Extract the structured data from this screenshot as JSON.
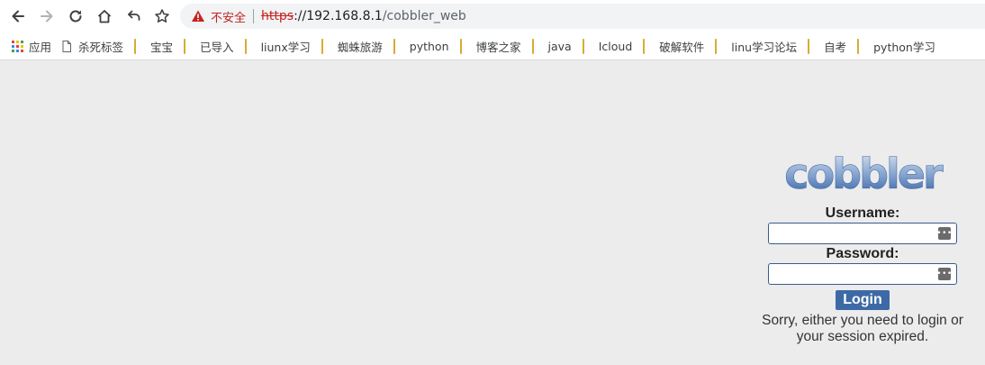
{
  "toolbar": {
    "back_icon": "arrow-left-icon",
    "forward_icon": "arrow-right-icon",
    "reload_icon": "reload-icon",
    "home_icon": "home-icon",
    "undo_icon": "undo-icon",
    "star_icon": "star-icon",
    "security_label": "不安全",
    "url_scheme": "https",
    "url_sep": "://",
    "url_host": "192.168.8.1",
    "url_path": "/cobbler_web"
  },
  "bookmarks": [
    {
      "label": "应用",
      "icon": "apps-grid-icon"
    },
    {
      "label": "杀死标签",
      "icon": "page-icon"
    },
    {
      "label": "宝宝",
      "icon": "folder-icon"
    },
    {
      "label": "已导入",
      "icon": "folder-icon"
    },
    {
      "label": "liunx学习",
      "icon": "folder-icon"
    },
    {
      "label": "蜘蛛旅游",
      "icon": "folder-icon"
    },
    {
      "label": "python",
      "icon": "folder-icon"
    },
    {
      "label": "博客之家",
      "icon": "folder-icon"
    },
    {
      "label": "java",
      "icon": "folder-icon"
    },
    {
      "label": "Icloud",
      "icon": "folder-icon"
    },
    {
      "label": "破解软件",
      "icon": "folder-icon"
    },
    {
      "label": "linu学习论坛",
      "icon": "folder-icon"
    },
    {
      "label": "自考",
      "icon": "folder-icon"
    },
    {
      "label": "python学习",
      "icon": "folder-icon"
    }
  ],
  "login": {
    "logo_text": "cobbler",
    "username_label": "Username:",
    "username_value": "",
    "password_label": "Password:",
    "password_value": "",
    "key_icon": "password-manager-key-icon",
    "submit_label": "Login",
    "message": "Sorry, either you need to login or your session expired."
  },
  "colors": {
    "page_background": "#ececec",
    "button_blue": "#3d6aa6",
    "insecure_red": "#c5221f"
  }
}
